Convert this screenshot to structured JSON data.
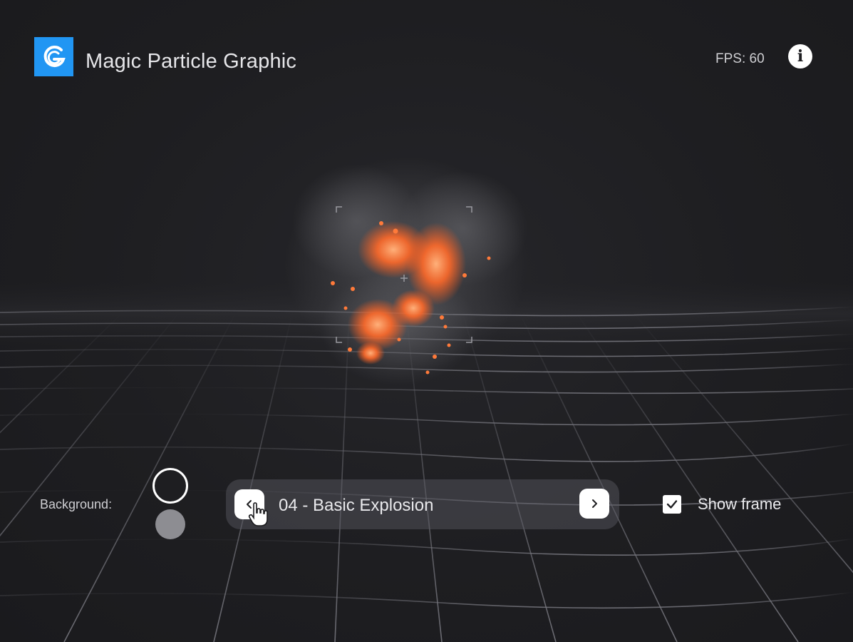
{
  "header": {
    "logo_icon": "g-logo-icon",
    "title": "Magic Particle Graphic",
    "fps_text": "FPS: 60",
    "info_icon": "info-icon",
    "info_glyph": "i"
  },
  "viewport": {
    "effect_icon": "explosion-particles",
    "colors": {
      "background": "#1f1f22",
      "grid_line": "#6e6e75",
      "fire": "#ff6a2a",
      "smoke": "#6b6b70",
      "accent": "#2196f3"
    }
  },
  "controls": {
    "background_label": "Background:",
    "swatches": [
      {
        "name": "dark",
        "color": "#1e1e21",
        "selected": true
      },
      {
        "name": "grey",
        "color": "#8d8d92",
        "selected": false
      }
    ],
    "effect_name": "04 - Basic Explosion",
    "prev_icon": "chevron-left-icon",
    "next_icon": "chevron-right-icon",
    "show_frame_label": "Show frame",
    "show_frame_checked": true
  }
}
